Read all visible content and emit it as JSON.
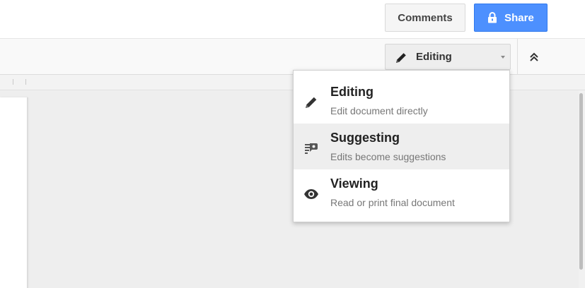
{
  "header": {
    "comments_label": "Comments",
    "share_label": "Share",
    "share_icon": "lock-icon"
  },
  "toolbar": {
    "mode_dropdown": {
      "selected_label": "Editing",
      "icon": "pencil-icon"
    },
    "collapse_icon": "double-chevron-up-icon"
  },
  "mode_menu": {
    "items": [
      {
        "title": "Editing",
        "description": "Edit document directly",
        "icon": "pencil-icon",
        "highlighted": false
      },
      {
        "title": "Suggesting",
        "description": "Edits become suggestions",
        "icon": "suggest-edit-icon",
        "highlighted": true
      },
      {
        "title": "Viewing",
        "description": "Read or print final document",
        "icon": "eye-icon",
        "highlighted": false
      }
    ]
  },
  "colors": {
    "share_button_bg": "#4d90fe",
    "share_button_text": "#ffffff",
    "comments_button_bg": "#f5f5f5",
    "menu_highlight_bg": "#eeeeee",
    "title_text": "#222222",
    "description_text": "#777777",
    "canvas_bg": "#eeeeee"
  }
}
